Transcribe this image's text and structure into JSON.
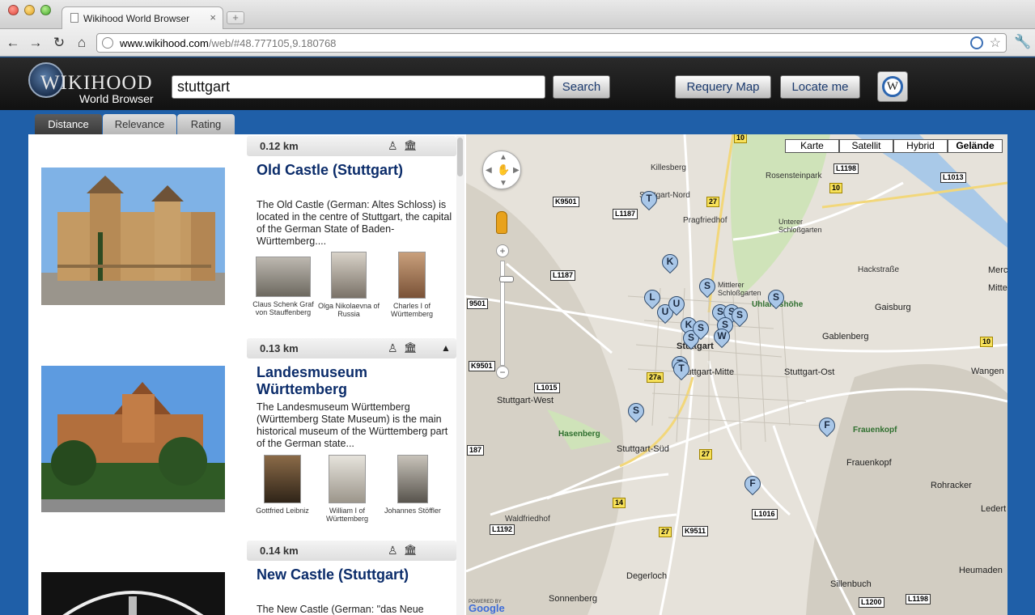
{
  "browser": {
    "tab_title": "Wikihood World Browser",
    "tab_close": "×",
    "new_tab": "+",
    "url_host": "www.wikihood.com",
    "url_path": "/web/#48.777105,9.180768",
    "icons": [
      "back-icon",
      "forward-icon",
      "reload-icon",
      "home-icon",
      "globe-icon",
      "extension-icon",
      "star-icon",
      "wrench-icon"
    ]
  },
  "header": {
    "logo_title": "WIKIHOOD",
    "logo_subtitle": "World Browser",
    "search_value": "stuttgart",
    "search_button": "Search",
    "requery_button": "Requery Map",
    "locate_button": "Locate me",
    "wiki_icon_letter": "W"
  },
  "sort_tabs": [
    "Distance",
    "Relevance",
    "Rating"
  ],
  "results": [
    {
      "distance": "0.12 km",
      "title": "Old Castle (Stuttgart)",
      "description": "The Old Castle (German: Altes Schloss) is located in the centre of Stuttgart, the capital of the German State of Baden-Württemberg....",
      "people": [
        "Claus Schenk Graf von Stauffenberg",
        "Olga Nikolaevna of Russia",
        "Charles I of Württemberg"
      ]
    },
    {
      "distance": "0.13 km",
      "title": "Landesmuseum Württemberg",
      "description": "The Landesmuseum Württemberg (Württemberg State Museum) is the main historical museum of the Württemberg part of the German state...",
      "people": [
        "Gottfried Leibniz",
        "William I of Württemberg",
        "Johannes Stöffler"
      ]
    },
    {
      "distance": "0.14 km",
      "title": "New Castle (Stuttgart)",
      "description": "The New Castle (German: \"das Neue"
    }
  ],
  "map": {
    "types": [
      "Karte",
      "Satellit",
      "Hybrid",
      "Gelände"
    ],
    "selected_type": "Gelände",
    "labels": {
      "killesberg": "Killesberg",
      "rosensteinpark": "Rosensteinpark",
      "stuttgart_nord": "Stuttgart-Nord",
      "pragfriedhof": "Pragfriedhof",
      "unterer_schlossgarten": "Unterer Schloßgarten",
      "mittlerer_schlossgarten": "Mittlerer Schloßgarten",
      "uhlandshohe": "Uhlandshöhe",
      "gaisburg": "Gaisburg",
      "gablenberg": "Gablenberg",
      "stuttgart_mitte": "Stuttgart-Mitte",
      "stuttgart_ost": "Stuttgart-Ost",
      "stuttgart_west": "Stuttgart-West",
      "stuttgart_sud": "Stuttgart-Süd",
      "hasenberg": "Hasenberg",
      "frauenkopf_park": "Frauenkopf",
      "frauenkopf": "Frauenkopf",
      "wangen": "Wangen",
      "rohracker": "Rohracker",
      "waldfriedhof": "Waldfriedhof",
      "degerloch": "Degerloch",
      "sonnenberg": "Sonnenberg",
      "sillenbuch": "Sillenbuch",
      "heumaden": "Heumaden",
      "merc": "Merc",
      "mitte": "Mitte",
      "hackstrasse": "Hackstraße",
      "stuttgart_center": "Stuttgart",
      "ledert": "Ledert"
    },
    "roads": {
      "l1198_top": "L1198",
      "l1013": "L1013",
      "k9501": "K9501",
      "l1187_a": "L1187",
      "l1187_b": "L1187",
      "k9501_b": "K9501",
      "l1015": "L1015",
      "l1016": "L1016",
      "k9511": "K9511",
      "l1192": "L1192",
      "l1200": "L1200",
      "l1198_bottom": "L1198",
      "r10_top": "10",
      "r10_mid": "10",
      "r10_right": "10",
      "r27_top": "27",
      "r27a": "27a",
      "r27_mid": "27",
      "r27_bottom": "27",
      "r14": "14",
      "r9501": "9501",
      "r187": "187"
    },
    "markers": [
      "T",
      "K",
      "S",
      "L",
      "U",
      "U",
      "S",
      "S",
      "S",
      "S",
      "K",
      "S",
      "S",
      "S",
      "W",
      "T",
      "T",
      "S",
      "F",
      "F"
    ],
    "powered_by": "POWERED BY",
    "google": "Google"
  }
}
